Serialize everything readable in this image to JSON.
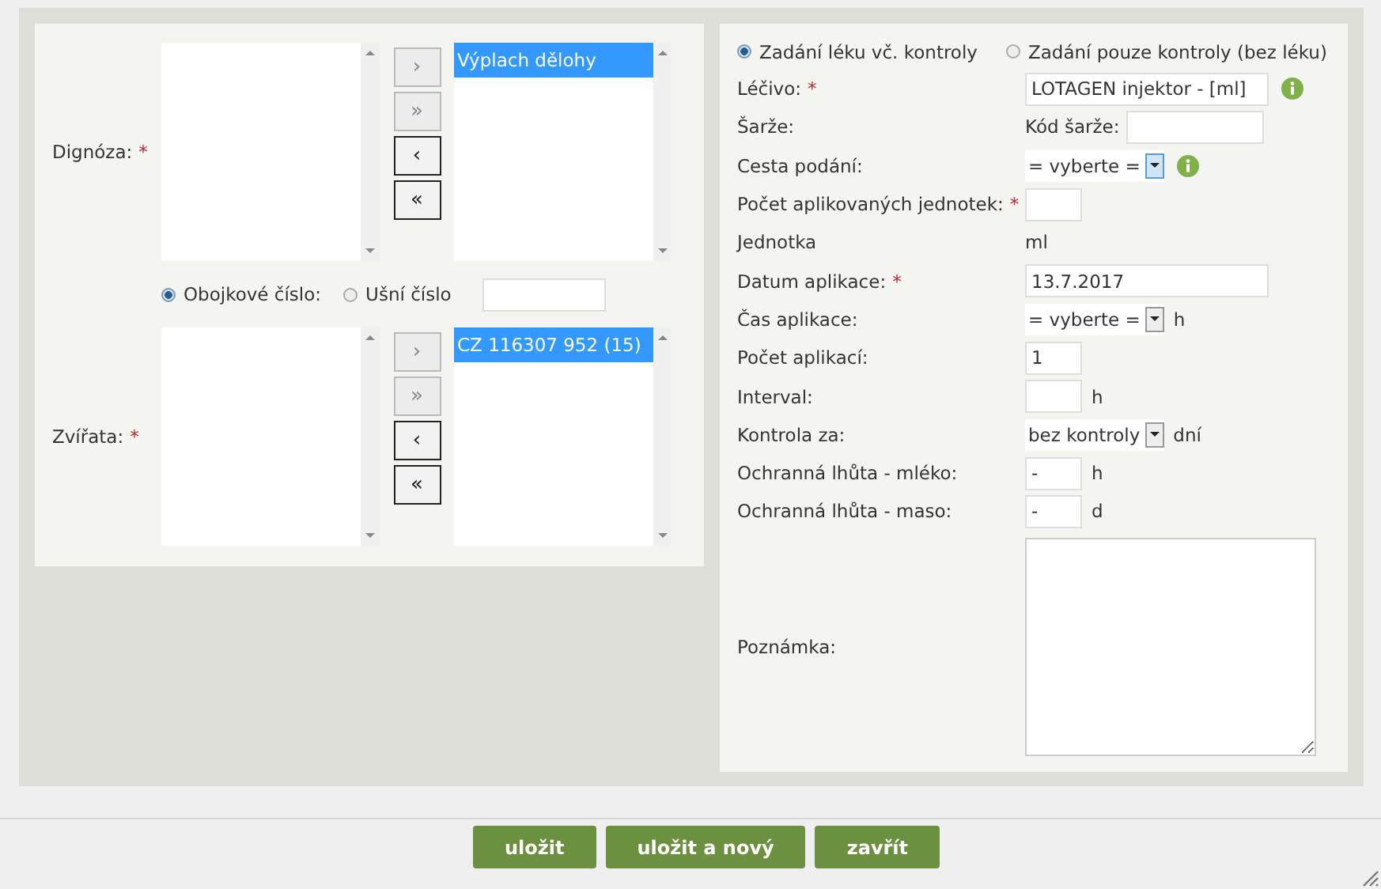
{
  "left": {
    "pickers": [
      {
        "label": "Dignóza:",
        "required_mark": "*",
        "chosen": [
          {
            "text": "Výplach dělohy",
            "selected": true
          }
        ],
        "buttons": [
          {
            "label": "›",
            "disabled": true
          },
          {
            "label": "»",
            "disabled": true
          },
          {
            "label": "‹",
            "disabled": false
          },
          {
            "label": "«",
            "disabled": false
          }
        ]
      },
      {
        "label": "Zvířata:",
        "required_mark": "*",
        "chosen": [
          {
            "text": "CZ 116307 952 (15)",
            "selected": true
          }
        ],
        "buttons": [
          {
            "label": "›",
            "disabled": true
          },
          {
            "label": "»",
            "disabled": true
          },
          {
            "label": "‹",
            "disabled": false
          },
          {
            "label": "«",
            "disabled": false
          }
        ]
      }
    ],
    "id_modes": [
      {
        "label": "Obojkové číslo:",
        "selected": true
      },
      {
        "label": "Ušní číslo",
        "selected": false
      }
    ]
  },
  "right": {
    "modes": [
      {
        "label": "Zadání léku vč. kontroly",
        "selected": true
      },
      {
        "label": "Zadání pouze kontroly (bez léku)",
        "selected": false
      }
    ],
    "rows": [
      {
        "kind": "wide-input",
        "label": "Léčivo:",
        "required_mark": "*",
        "value": "LOTAGEN injektor - [ml]",
        "info": true
      },
      {
        "kind": "prefixed",
        "label": "Šarže:",
        "prefix": "Kód šarže:"
      },
      {
        "kind": "select",
        "label": "Cesta podání:",
        "value": "= vyberte =",
        "focused": true,
        "info": true
      },
      {
        "kind": "small-input",
        "label": "Počet aplikovaných jednotek:",
        "required_mark": "*"
      },
      {
        "kind": "static",
        "label": "Jednotka",
        "value": "ml"
      },
      {
        "kind": "wide-input",
        "label": "Datum aplikace:",
        "required_mark": "*",
        "value": "13.7.2017"
      },
      {
        "kind": "select",
        "label": "Čas aplikace:",
        "value": "= vyberte =",
        "focused": false,
        "suffix": "h"
      },
      {
        "kind": "small-input",
        "label": "Počet aplikací:",
        "value": "1"
      },
      {
        "kind": "small-input",
        "label": "Interval:",
        "suffix": "h"
      },
      {
        "kind": "select",
        "label": "Kontrola za:",
        "value": "bez kontroly",
        "focused": false,
        "suffix": "dní"
      },
      {
        "kind": "small-input",
        "label": "Ochranná lhůta - mléko:",
        "value": "-",
        "suffix": "h"
      },
      {
        "kind": "small-input",
        "label": "Ochranná lhůta - maso:",
        "value": "-",
        "suffix": "d"
      },
      {
        "kind": "textarea",
        "label": "Poznámka:"
      }
    ]
  },
  "buttons": [
    "uložit",
    "uložit a nový",
    "zavřít"
  ]
}
